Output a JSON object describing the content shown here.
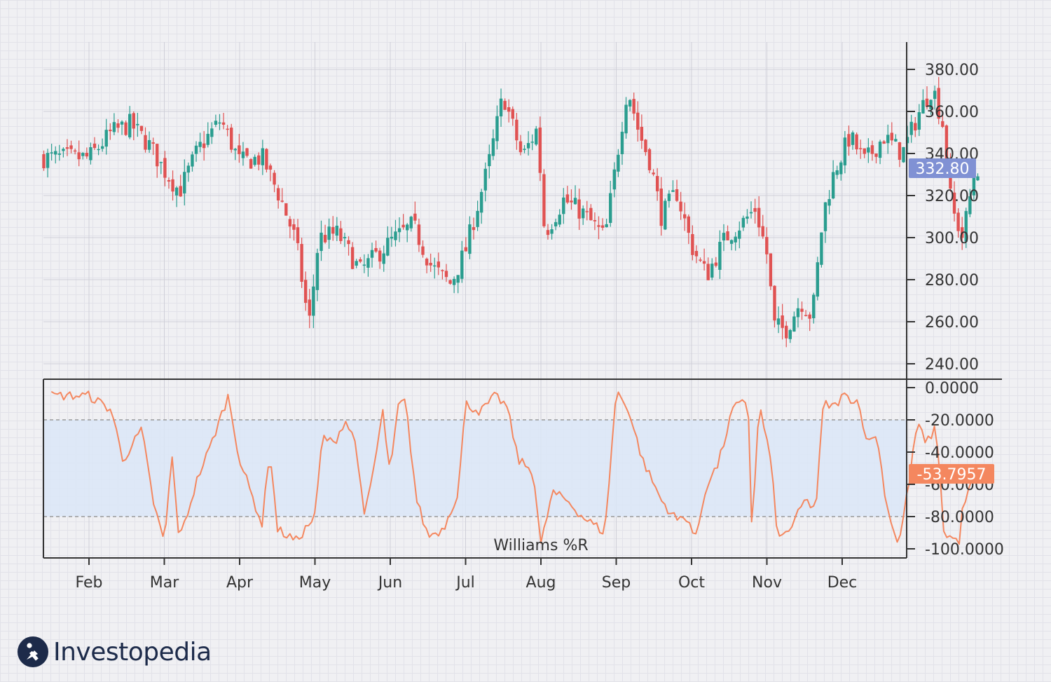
{
  "brand": {
    "name": "Investopedia",
    "primary": "#1d2b4a"
  },
  "colors": {
    "up": "#2a9d8f",
    "down": "#e05252",
    "wpr_line": "#f4875f",
    "price_tag": "#8091d4",
    "wpr_tag": "#f4875f",
    "band_fill": "#dbe6f7"
  },
  "chart_data": [
    {
      "type": "candlestick",
      "title": "",
      "x_labels": [
        "Feb",
        "Mar",
        "Apr",
        "May",
        "Jun",
        "Jul",
        "Aug",
        "Sep",
        "Oct",
        "Nov",
        "Dec"
      ],
      "y_ticks": [
        "380.00",
        "360.00",
        "340.00",
        "320.00",
        "300.00",
        "280.00",
        "260.00",
        "240.00"
      ],
      "ylim": [
        234,
        394
      ],
      "last_price_label": "332.80",
      "close_anchors": [
        {
          "m": 0.0,
          "v": 338
        },
        {
          "m": 0.3,
          "v": 350
        },
        {
          "m": 0.55,
          "v": 354
        },
        {
          "m": 0.8,
          "v": 344
        },
        {
          "m": 1.0,
          "v": 332
        },
        {
          "m": 1.2,
          "v": 322
        },
        {
          "m": 1.45,
          "v": 342
        },
        {
          "m": 1.75,
          "v": 356
        },
        {
          "m": 2.0,
          "v": 336
        },
        {
          "m": 2.3,
          "v": 338
        },
        {
          "m": 2.55,
          "v": 318
        },
        {
          "m": 2.75,
          "v": 298
        },
        {
          "m": 2.92,
          "v": 258
        },
        {
          "m": 3.05,
          "v": 300
        },
        {
          "m": 3.3,
          "v": 302
        },
        {
          "m": 3.6,
          "v": 284
        },
        {
          "m": 4.0,
          "v": 298
        },
        {
          "m": 4.3,
          "v": 306
        },
        {
          "m": 4.55,
          "v": 286
        },
        {
          "m": 4.8,
          "v": 278
        },
        {
          "m": 5.0,
          "v": 294
        },
        {
          "m": 5.3,
          "v": 334
        },
        {
          "m": 5.5,
          "v": 368
        },
        {
          "m": 5.75,
          "v": 338
        },
        {
          "m": 5.95,
          "v": 352
        },
        {
          "m": 6.05,
          "v": 302
        },
        {
          "m": 6.3,
          "v": 318
        },
        {
          "m": 6.55,
          "v": 312
        },
        {
          "m": 6.85,
          "v": 300
        },
        {
          "m": 7.0,
          "v": 336
        },
        {
          "m": 7.15,
          "v": 372
        },
        {
          "m": 7.3,
          "v": 350
        },
        {
          "m": 7.45,
          "v": 336
        },
        {
          "m": 7.6,
          "v": 310
        },
        {
          "m": 7.8,
          "v": 322
        },
        {
          "m": 8.0,
          "v": 296
        },
        {
          "m": 8.2,
          "v": 282
        },
        {
          "m": 8.45,
          "v": 300
        },
        {
          "m": 8.7,
          "v": 308
        },
        {
          "m": 8.85,
          "v": 314
        },
        {
          "m": 9.0,
          "v": 292
        },
        {
          "m": 9.1,
          "v": 258
        },
        {
          "m": 9.25,
          "v": 256
        },
        {
          "m": 9.45,
          "v": 270
        },
        {
          "m": 9.6,
          "v": 262
        },
        {
          "m": 9.75,
          "v": 312
        },
        {
          "m": 9.9,
          "v": 332
        },
        {
          "m": 10.1,
          "v": 348
        },
        {
          "m": 10.3,
          "v": 336
        },
        {
          "m": 10.55,
          "v": 348
        },
        {
          "m": 10.8,
          "v": 340
        },
        {
          "m": 11.0,
          "v": 358
        },
        {
          "m": 11.2,
          "v": 372
        },
        {
          "m": 11.35,
          "v": 352
        },
        {
          "m": 11.45,
          "v": 314
        },
        {
          "m": 11.6,
          "v": 300
        },
        {
          "m": 11.75,
          "v": 330
        },
        {
          "m": 11.8,
          "v": 333
        }
      ]
    },
    {
      "type": "line",
      "title": "Williams %R",
      "series": [
        {
          "name": "Williams %R"
        }
      ],
      "y_ticks": [
        "0.0000",
        "-20.0000",
        "-40.0000",
        "-60.0000",
        "-80.0000",
        "-100.0000"
      ],
      "ylim": [
        -105,
        4
      ],
      "overbought": -20,
      "oversold": -80,
      "last_value_label": "-53.7957",
      "anchors": [
        {
          "m": 0.0,
          "v": -5
        },
        {
          "m": 0.3,
          "v": -14
        },
        {
          "m": 0.45,
          "v": -45
        },
        {
          "m": 0.7,
          "v": -26
        },
        {
          "m": 0.85,
          "v": -70
        },
        {
          "m": 1.0,
          "v": -97
        },
        {
          "m": 1.1,
          "v": -42
        },
        {
          "m": 1.2,
          "v": -95
        },
        {
          "m": 1.45,
          "v": -55
        },
        {
          "m": 1.6,
          "v": -38
        },
        {
          "m": 1.75,
          "v": -18
        },
        {
          "m": 1.85,
          "v": -5
        },
        {
          "m": 2.0,
          "v": -45
        },
        {
          "m": 2.2,
          "v": -72
        },
        {
          "m": 2.3,
          "v": -85
        },
        {
          "m": 2.4,
          "v": -37
        },
        {
          "m": 2.5,
          "v": -88
        },
        {
          "m": 2.75,
          "v": -95
        },
        {
          "m": 3.0,
          "v": -80
        },
        {
          "m": 3.1,
          "v": -30
        },
        {
          "m": 3.25,
          "v": -35
        },
        {
          "m": 3.4,
          "v": -20
        },
        {
          "m": 3.55,
          "v": -35
        },
        {
          "m": 3.65,
          "v": -82
        },
        {
          "m": 3.8,
          "v": -45
        },
        {
          "m": 3.9,
          "v": -15
        },
        {
          "m": 4.0,
          "v": -55
        },
        {
          "m": 4.1,
          "v": -12
        },
        {
          "m": 4.2,
          "v": -8
        },
        {
          "m": 4.35,
          "v": -70
        },
        {
          "m": 4.5,
          "v": -92
        },
        {
          "m": 4.7,
          "v": -88
        },
        {
          "m": 4.9,
          "v": -65
        },
        {
          "m": 5.0,
          "v": -10
        },
        {
          "m": 5.2,
          "v": -15
        },
        {
          "m": 5.4,
          "v": -5
        },
        {
          "m": 5.55,
          "v": -12
        },
        {
          "m": 5.7,
          "v": -45
        },
        {
          "m": 5.9,
          "v": -52
        },
        {
          "m": 6.0,
          "v": -98
        },
        {
          "m": 6.15,
          "v": -65
        },
        {
          "m": 6.35,
          "v": -70
        },
        {
          "m": 6.55,
          "v": -80
        },
        {
          "m": 6.85,
          "v": -90
        },
        {
          "m": 7.0,
          "v": -2
        },
        {
          "m": 7.15,
          "v": -12
        },
        {
          "m": 7.35,
          "v": -45
        },
        {
          "m": 7.6,
          "v": -70
        },
        {
          "m": 7.8,
          "v": -82
        },
        {
          "m": 7.95,
          "v": -80
        },
        {
          "m": 8.05,
          "v": -95
        },
        {
          "m": 8.2,
          "v": -60
        },
        {
          "m": 8.35,
          "v": -48
        },
        {
          "m": 8.55,
          "v": -13
        },
        {
          "m": 8.75,
          "v": -8
        },
        {
          "m": 8.8,
          "v": -88
        },
        {
          "m": 8.9,
          "v": -10
        },
        {
          "m": 9.05,
          "v": -45
        },
        {
          "m": 9.15,
          "v": -95
        },
        {
          "m": 9.35,
          "v": -85
        },
        {
          "m": 9.5,
          "v": -70
        },
        {
          "m": 9.65,
          "v": -75
        },
        {
          "m": 9.75,
          "v": -10
        },
        {
          "m": 9.9,
          "v": -12
        },
        {
          "m": 10.0,
          "v": -5
        },
        {
          "m": 10.2,
          "v": -8
        },
        {
          "m": 10.35,
          "v": -35
        },
        {
          "m": 10.45,
          "v": -28
        },
        {
          "m": 10.6,
          "v": -75
        },
        {
          "m": 10.75,
          "v": -98
        },
        {
          "m": 10.9,
          "v": -55
        },
        {
          "m": 11.0,
          "v": -20
        },
        {
          "m": 11.1,
          "v": -35
        },
        {
          "m": 11.25,
          "v": -25
        },
        {
          "m": 11.35,
          "v": -90
        },
        {
          "m": 11.55,
          "v": -96
        },
        {
          "m": 11.6,
          "v": -75
        },
        {
          "m": 11.75,
          "v": -55
        },
        {
          "m": 11.8,
          "v": -54
        }
      ]
    }
  ]
}
